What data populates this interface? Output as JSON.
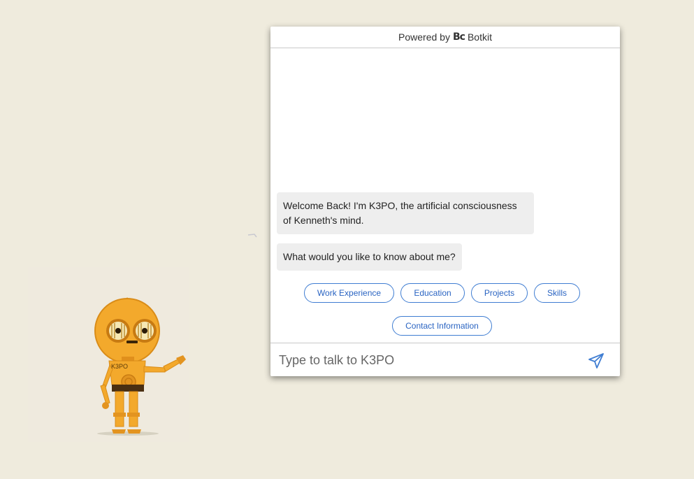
{
  "header": {
    "powered_by": "Powered by",
    "logo_glyph": "Bc",
    "brand": "Botkit"
  },
  "robot": {
    "chest_label": "K3PO"
  },
  "messages": [
    {
      "text": "Welcome Back! I'm K3PO, the artificial consciousness of Kenneth's mind."
    },
    {
      "text": "What would you like to know about me?"
    }
  ],
  "quick_replies": [
    {
      "label": "Work Experience"
    },
    {
      "label": "Education"
    },
    {
      "label": "Projects"
    },
    {
      "label": "Skills"
    },
    {
      "label": "Contact Information"
    }
  ],
  "input": {
    "placeholder": "Type to talk to K3PO",
    "value": ""
  },
  "icons": {
    "send": "send-paper-plane-icon"
  },
  "colors": {
    "page_bg": "#efebdd",
    "accent": "#3f7dd2",
    "robot_gold": "#f0a32a"
  }
}
